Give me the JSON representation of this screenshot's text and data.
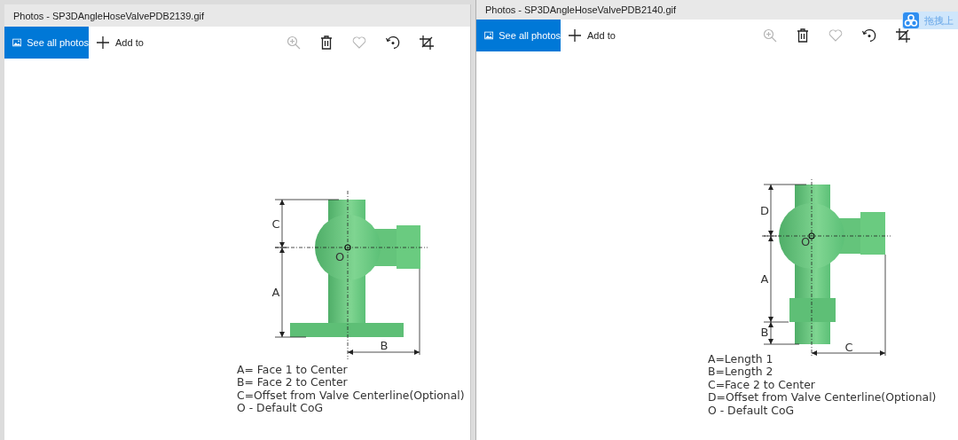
{
  "windows": [
    {
      "title": "Photos - SP3DAngleHoseValvePDB2139.gif",
      "see_all": "See all photos",
      "add_to": "Add to",
      "tools": [
        {
          "kind": "zoom",
          "disabled": true
        },
        {
          "kind": "delete",
          "disabled": false
        },
        {
          "kind": "favorite",
          "disabled": true
        },
        {
          "kind": "rotate",
          "disabled": false
        },
        {
          "kind": "crop",
          "disabled": false
        }
      ],
      "drawing": {
        "kind": "flanged",
        "labels": [
          "C",
          "A",
          "B",
          "O"
        ]
      },
      "legend": [
        "A= Face 1 to Center",
        "B= Face 2 to Center",
        "C=Offset from Valve Centerline(Optional)",
        "O - Default CoG"
      ]
    },
    {
      "title": "Photos - SP3DAngleHoseValvePDB2140.gif",
      "see_all": "See all photos",
      "add_to": "Add to",
      "tools": [
        {
          "kind": "zoom",
          "disabled": true
        },
        {
          "kind": "delete",
          "disabled": false
        },
        {
          "kind": "favorite",
          "disabled": true
        },
        {
          "kind": "rotate",
          "disabled": false
        },
        {
          "kind": "crop",
          "disabled": false
        }
      ],
      "drawing": {
        "kind": "socket",
        "labels": [
          "D",
          "A",
          "B",
          "C",
          "O"
        ]
      },
      "legend": [
        "A=Length 1",
        "B=Length 2",
        "C=Face 2 to Center",
        "D=Offset from Valve Centerline(Optional)",
        "O - Default CoG"
      ]
    }
  ],
  "upload_widget": {
    "label": "拖拽上"
  }
}
